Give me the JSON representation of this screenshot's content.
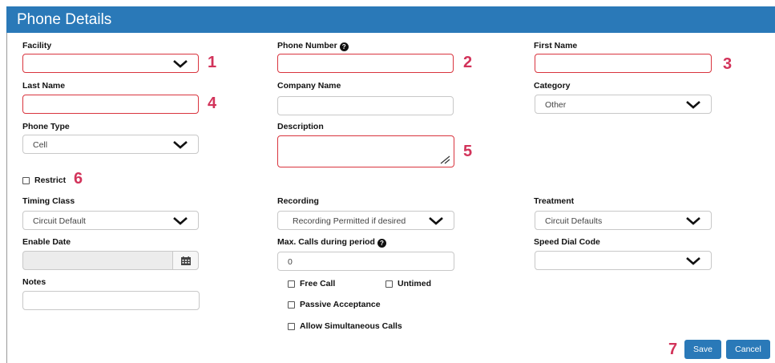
{
  "header": {
    "title": "Phone Details"
  },
  "callouts": [
    "1",
    "2",
    "3",
    "4",
    "5",
    "6",
    "7"
  ],
  "fields": {
    "facility": {
      "label": "Facility",
      "value": ""
    },
    "phone_number": {
      "label": "Phone Number",
      "value": ""
    },
    "first_name": {
      "label": "First Name",
      "value": ""
    },
    "last_name": {
      "label": "Last Name",
      "value": ""
    },
    "company_name": {
      "label": "Company Name",
      "value": ""
    },
    "category": {
      "label": "Category",
      "value": "Other"
    },
    "phone_type": {
      "label": "Phone  Type",
      "value": "Cell"
    },
    "description": {
      "label": "Description",
      "value": ""
    },
    "restrict": {
      "label": "Restrict",
      "checked": false
    },
    "timing_class": {
      "label": "Timing Class",
      "value": "Circuit Default"
    },
    "recording": {
      "label": "Recording",
      "value": "Recording Permitted if desired"
    },
    "treatment": {
      "label": "Treatment",
      "value": "Circuit Defaults"
    },
    "enable_date": {
      "label": "Enable Date",
      "value": ""
    },
    "max_calls": {
      "label": "Max. Calls during period",
      "value": "0"
    },
    "speed_dial": {
      "label": "Speed Dial Code",
      "value": ""
    },
    "notes": {
      "label": "Notes",
      "value": ""
    }
  },
  "checkboxes": {
    "free_call": "Free Call",
    "untimed": "Untimed",
    "passive_acceptance": "Passive Acceptance",
    "allow_simultaneous": "Allow Simultaneous Calls"
  },
  "buttons": {
    "save": "Save",
    "cancel": "Cancel"
  },
  "icons": {
    "help": "question-circle-icon",
    "calendar": "calendar-icon",
    "dropdown": "chevron-down-icon",
    "resize": "resize-handle-icon"
  },
  "colors": {
    "header": "#2a79b8",
    "error_border": "#d9343e",
    "callout": "#d2335a",
    "button": "#2a79b8"
  }
}
